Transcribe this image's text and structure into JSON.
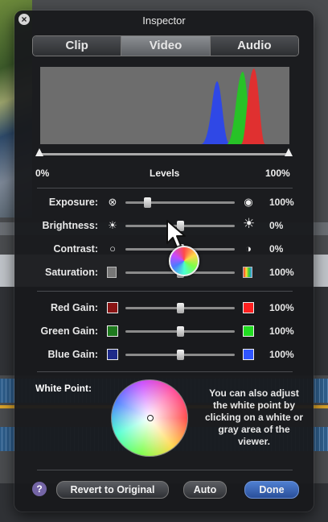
{
  "inspector": {
    "title": "Inspector",
    "tabs": [
      {
        "label": "Clip"
      },
      {
        "label": "Video",
        "active": true
      },
      {
        "label": "Audio"
      }
    ],
    "levels": {
      "label": "Levels",
      "min_label": "0%",
      "max_label": "100%"
    },
    "adjustments": [
      {
        "label": "Exposure:",
        "value": "100%",
        "level": 0.2
      },
      {
        "label": "Brightness:",
        "value": "0%",
        "level": 0.5
      },
      {
        "label": "Contrast:",
        "value": "0%",
        "level": 0.5
      },
      {
        "label": "Saturation:",
        "value": "100%",
        "level": 0.5
      }
    ],
    "gains": [
      {
        "label": "Red Gain:",
        "value": "100%",
        "level": 0.5,
        "low_color": "#8a1414",
        "high_color": "#ff2020"
      },
      {
        "label": "Green Gain:",
        "value": "100%",
        "level": 0.5,
        "low_color": "#1e7a1e",
        "high_color": "#22dd22"
      },
      {
        "label": "Blue Gain:",
        "value": "100%",
        "level": 0.5,
        "low_color": "#1e2a8a",
        "high_color": "#2f55ff"
      }
    ],
    "white_point": {
      "label": "White Point:",
      "help_text": "You can also adjust the white point by clicking on a white or gray area of the viewer."
    },
    "buttons": {
      "help": "?",
      "revert": "Revert to Original",
      "auto": "Auto",
      "done": "Done"
    },
    "accent_color": "#3a67c4"
  }
}
